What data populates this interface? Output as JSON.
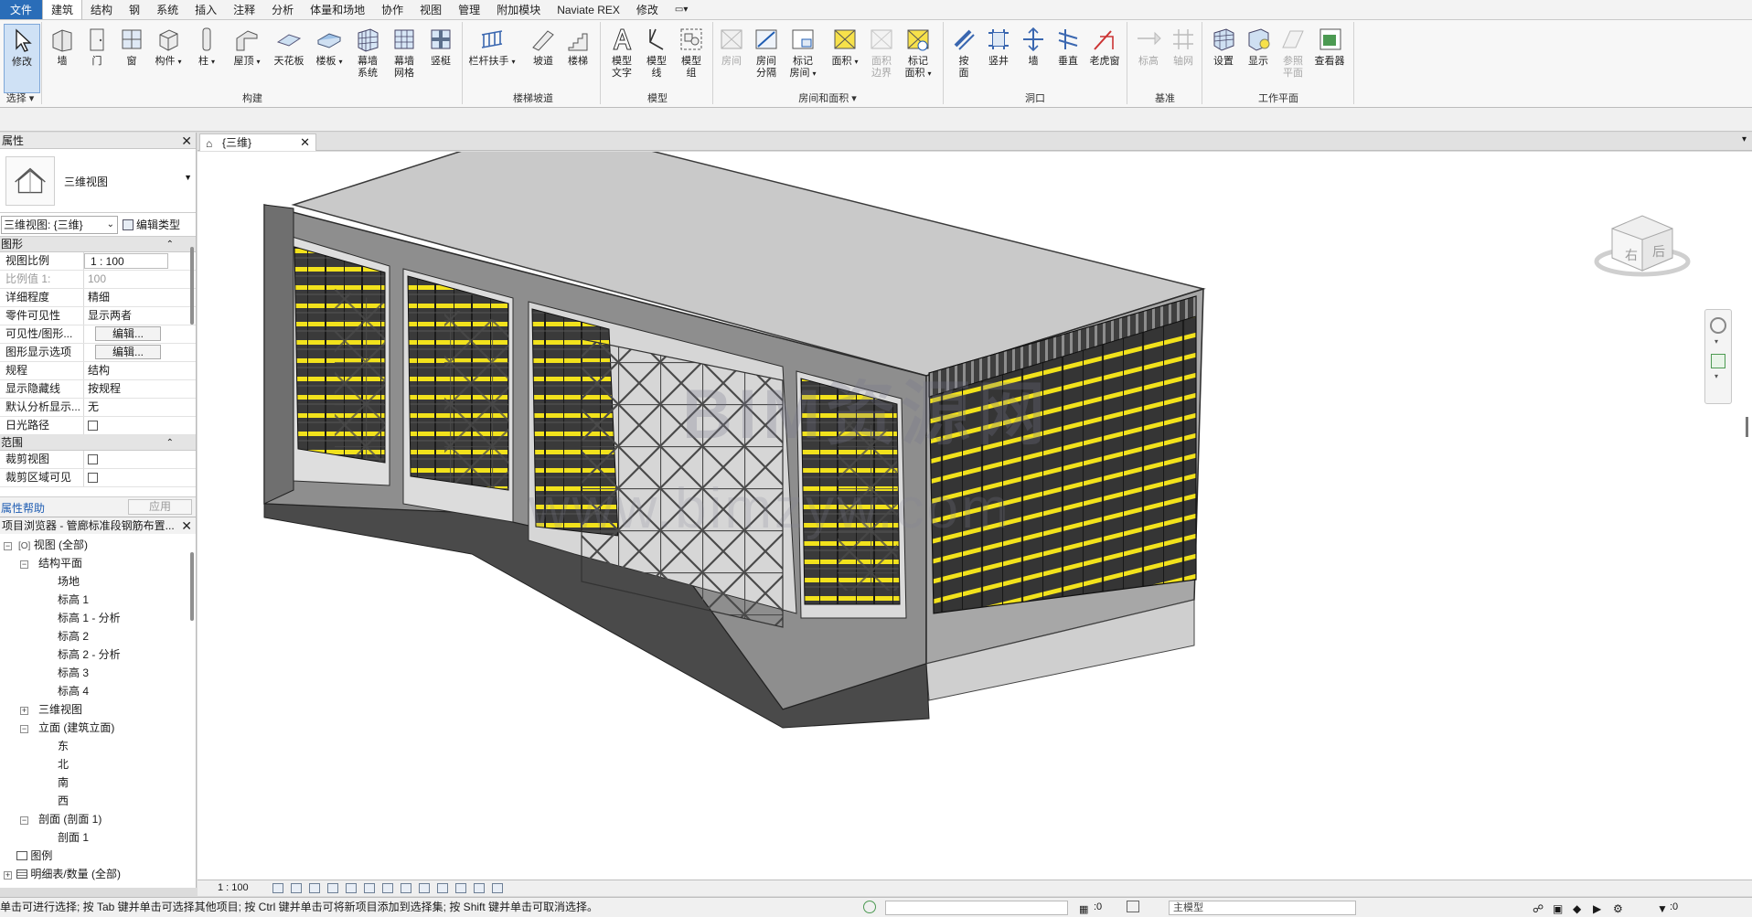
{
  "menu": {
    "tabs": [
      "文件",
      "建筑",
      "结构",
      "钢",
      "系统",
      "插入",
      "注释",
      "分析",
      "体量和场地",
      "协作",
      "视图",
      "管理",
      "附加模块",
      "Naviate REX",
      "修改"
    ],
    "active_tab": "建筑"
  },
  "ribbon": {
    "select": {
      "modify": "修改",
      "group": "选择"
    },
    "build": {
      "wall": "墙",
      "door": "门",
      "window": "窗",
      "component": "构件",
      "column": "柱",
      "roof": "屋顶",
      "ceiling": "天花板",
      "floor": "楼板",
      "curtain_system_1": "幕墙",
      "curtain_system_2": "系统",
      "curtain_grid_1": "幕墙",
      "curtain_grid_2": "网格",
      "mullion": "竖梃",
      "group": "构建"
    },
    "circulation": {
      "railing": "栏杆扶手",
      "ramp": "坡道",
      "stair": "楼梯",
      "group": "楼梯坡道"
    },
    "model": {
      "text_1": "模型",
      "text_2": "文字",
      "line_1": "模型",
      "line_2": "线",
      "mgroup_1": "模型",
      "mgroup_2": "组",
      "group": "模型"
    },
    "room": {
      "room": "房间",
      "sep_1": "房间",
      "sep_2": "分隔",
      "tag_1": "标记",
      "tag_2": "房间",
      "area": "面积",
      "ab_1": "面积",
      "ab_2": "边界",
      "atag_1": "标记",
      "atag_2": "面积",
      "group": "房间和面积"
    },
    "opening": {
      "byface_1": "按",
      "byface_2": "面",
      "shaft": "竖井",
      "wall": "墙",
      "vertical": "垂直",
      "dormer": "老虎窗",
      "group": "洞口"
    },
    "datum": {
      "level": "标高",
      "grid": "轴网",
      "group": "基准"
    },
    "workplane": {
      "set": "设置",
      "show": "显示",
      "ref_1": "参照",
      "ref_2": "平面",
      "viewer": "查看器",
      "group": "工作平面"
    }
  },
  "properties": {
    "title": "属性",
    "type_name": "三维视图",
    "instance": "三维视图: {三维}",
    "edit_type": "编辑类型",
    "section_graphics": "图形",
    "rows": [
      {
        "k": "视图比例",
        "v": "1 : 100"
      },
      {
        "k": "比例值 1:",
        "v": "100"
      },
      {
        "k": "详细程度",
        "v": "精细"
      },
      {
        "k": "零件可见性",
        "v": "显示两者"
      },
      {
        "k": "可见性/图形...",
        "v": "编辑..."
      },
      {
        "k": "图形显示选项",
        "v": "编辑..."
      },
      {
        "k": "规程",
        "v": "结构"
      },
      {
        "k": "显示隐藏线",
        "v": "按规程"
      },
      {
        "k": "默认分析显示...",
        "v": "无"
      },
      {
        "k": "日光路径",
        "v": ""
      }
    ],
    "section_extents": "范围",
    "rows2": [
      {
        "k": "裁剪视图",
        "v": ""
      },
      {
        "k": "裁剪区域可见",
        "v": ""
      }
    ],
    "help": "属性帮助",
    "apply": "应用"
  },
  "browser": {
    "title": "项目浏览器 - 管廊标准段钢筋布置...",
    "nodes": [
      "视图 (全部)",
      "结构平面",
      "场地",
      "标高 1",
      "标高 1 - 分析",
      "标高 2",
      "标高 2 - 分析",
      "标高 3",
      "标高 4",
      "三维视图",
      "立面 (建筑立面)",
      "东",
      "北",
      "南",
      "西",
      "剖面 (剖面 1)",
      "剖面 1",
      "图例",
      "明细表/数量 (全部)"
    ]
  },
  "view": {
    "tab_label": "{三维}",
    "watermark_main": "BIM资源网",
    "watermark_url": "www.bimzyw.com",
    "cube_right": "右",
    "cube_back": "后",
    "scale": "1 : 100"
  },
  "status": {
    "message": "单击可进行选择; 按 Tab 键并单击可选择其他项目; 按 Ctrl 键并单击可将新项目添加到选择集; 按 Shift 键并单击可取消选择。",
    "count_a": ":0",
    "model": "主模型",
    "count_b": ":0"
  },
  "colors": {
    "accent": "#2a6db8",
    "formwork_yellow": "#f2e21c",
    "concrete": "#8e8e8e"
  }
}
